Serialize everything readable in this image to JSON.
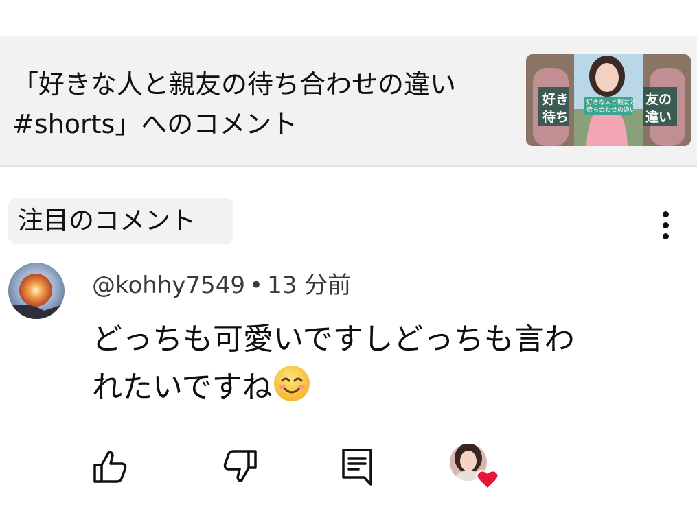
{
  "video": {
    "title_line1": "「好きな人と親友の待ち合わせの違い",
    "title_line2": "#shorts」へのコメント",
    "thumbnail": {
      "left_text": "好き\n待ち",
      "right_text": "友の\n違い",
      "caption": "好きな人と親友と\n待ち合わせの違い"
    }
  },
  "section": {
    "chip_label": "注目のコメント",
    "more_icon": "more-vert-icon"
  },
  "comment": {
    "author": "@kohhy7549",
    "separator": "•",
    "time": "13 分前",
    "text": "どっちも可愛いですしどっちも言わ\nれたいですね",
    "emoji": "smiling-face-emoji",
    "actions": {
      "like_icon": "thumb-up-icon",
      "dislike_icon": "thumb-down-icon",
      "reply_icon": "reply-icon",
      "creator_heart": "creator-heart-icon"
    }
  },
  "colors": {
    "header_bg": "#f2f2f2",
    "text": "#0f0f0f",
    "meta_text": "#3a3a3a",
    "heart": "#e8173a"
  }
}
